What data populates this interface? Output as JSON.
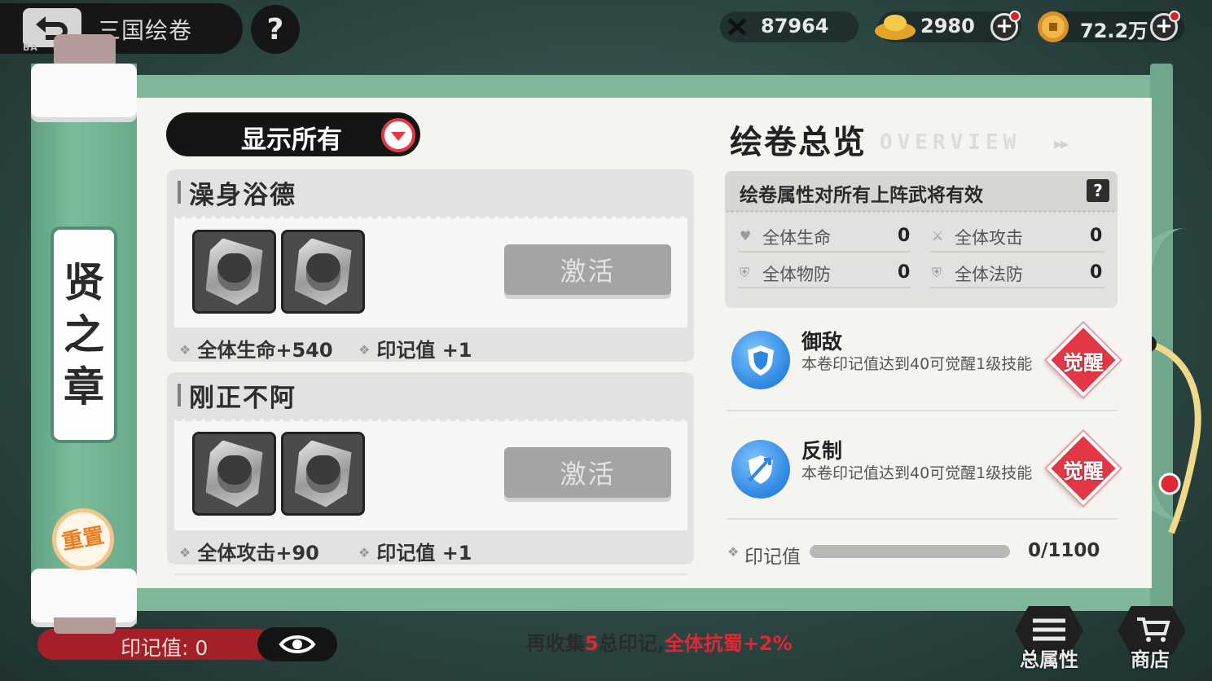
{
  "header": {
    "back_sub": "BA",
    "title": "三国绘卷",
    "help_label": "?",
    "resources": [
      {
        "icon": "crossed-swords-icon",
        "value": "87964"
      },
      {
        "icon": "gold-ingot-icon",
        "value": "2980"
      },
      {
        "icon": "coin-icon",
        "value": "72.2万"
      }
    ]
  },
  "chapter": {
    "chars": [
      "贤",
      "之",
      "章"
    ],
    "reset_label": "重置"
  },
  "filter": {
    "label": "显示所有"
  },
  "groups": [
    {
      "title": "澡身浴德",
      "activate_label": "激活",
      "attr": "全体生命+540",
      "mark": "印记值 +1"
    },
    {
      "title": "刚正不阿",
      "activate_label": "激活",
      "attr": "全体攻击+90",
      "mark": "印记值 +1"
    }
  ],
  "overview": {
    "title": "绘卷总览",
    "subtitle": "OVERVIEW",
    "arrows": "▸▸",
    "note": "绘卷属性对所有上阵武将有效",
    "q": "?",
    "stats": [
      {
        "name": "全体生命",
        "value": "0"
      },
      {
        "name": "全体攻击",
        "value": "0"
      },
      {
        "name": "全体物防",
        "value": "0"
      },
      {
        "name": "全体法防",
        "value": "0"
      }
    ],
    "skills": [
      {
        "name": "御敌",
        "desc": "本卷印记值达到40可觉醒1级技能",
        "awaken_label": "觉醒"
      },
      {
        "name": "反制",
        "desc": "本卷印记值达到40可觉醒1级技能",
        "awaken_label": "觉醒"
      }
    ],
    "mark_label": "印记值",
    "mark_value": "0/1100",
    "mark_progress": 0
  },
  "footer": {
    "mark_text": "印记值: 0",
    "tip_pre": "再收集",
    "tip_num": "5",
    "tip_mid": "总印记,",
    "tip_red": "全体抗蜀+2%",
    "buttons": [
      {
        "icon": "total-attributes-icon",
        "label": "总属性"
      },
      {
        "icon": "shop-cart-icon",
        "label": "商店"
      }
    ]
  },
  "colors": {
    "accent_red": "#e23846",
    "scroll_green": "#7fb79b",
    "orange": "#ee7d1e"
  }
}
